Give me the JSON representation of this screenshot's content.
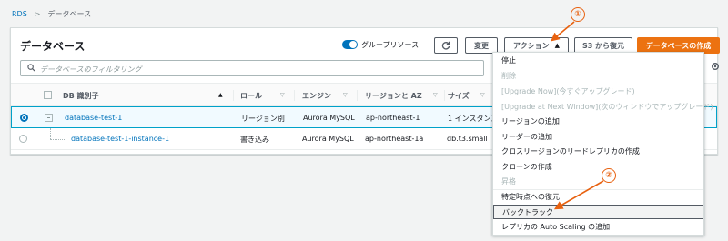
{
  "breadcrumb": {
    "root": "RDS",
    "separator": ">",
    "current": "データベース"
  },
  "panel": {
    "title": "データベース",
    "group_toggle_label": "グループリソース",
    "buttons": {
      "refresh_icon": "refresh-icon",
      "modify": "変更",
      "actions": "アクション",
      "actions_caret": "▲",
      "restore_s3": "S3 から復元",
      "create": "データベースの作成"
    },
    "search_placeholder": "データベースのフィルタリング"
  },
  "table": {
    "columns": [
      "DB 識別子",
      "ロール",
      "エンジン",
      "リージョンと AZ",
      "サイズ"
    ],
    "rows": [
      {
        "identifier": "database-test-1",
        "role": "リージョン別",
        "engine": "Aurora MySQL",
        "region": "ap-northeast-1",
        "size": "1 インスタンス"
      },
      {
        "identifier": "database-test-1-instance-1",
        "role": "書き込み",
        "engine": "Aurora MySQL",
        "region": "ap-northeast-1a",
        "size": "db.t3.small"
      }
    ]
  },
  "actions_menu": {
    "items": [
      {
        "label": "停止",
        "disabled": false
      },
      {
        "label": "削除",
        "disabled": true
      },
      {
        "label": "[Upgrade Now](今すぐアップグレード)",
        "disabled": true
      },
      {
        "label": "[Upgrade at Next Window](次のウィンドウでアップグレード)",
        "disabled": true
      },
      {
        "label": "リージョンの追加",
        "disabled": false
      },
      {
        "label": "リーダーの追加",
        "disabled": false
      },
      {
        "label": "クロスリージョンのリードレプリカの作成",
        "disabled": false
      },
      {
        "label": "クローンの作成",
        "disabled": false
      },
      {
        "label": "昇格",
        "disabled": true
      },
      {
        "label": "特定時点への復元",
        "disabled": false
      },
      {
        "label": "バックトラック",
        "disabled": false,
        "highlighted": true
      },
      {
        "label": "レプリカの Auto Scaling の追加",
        "disabled": false
      }
    ]
  },
  "annotations": {
    "marker_1": "①",
    "marker_2": "②",
    "color": "#e8610f"
  },
  "colors": {
    "accent": "#0073bb",
    "primary_button": "#ec7211"
  }
}
